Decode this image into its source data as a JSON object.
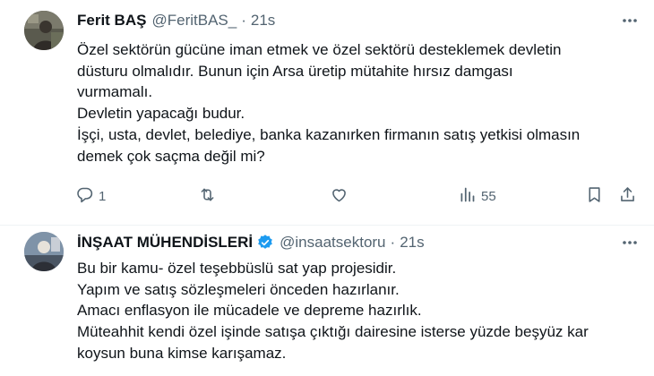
{
  "tweets": [
    {
      "author_name": "Ferit BAŞ",
      "handle": "@FeritBAS_",
      "separator": "·",
      "time": "21s",
      "lines": [
        "Özel sektörün gücüne iman etmek ve özel sektörü desteklemek devletin",
        "düsturu olmalıdır. Bunun için Arsa üretip mütahite hırsız damgası",
        "vurmamalı.",
        "Devletin yapacağı budur.",
        "İşçi, usta, devlet, belediye, banka kazanırken firmanın satış yetkisi olmasın",
        "demek çok saçma değil mi?"
      ],
      "reply_count": "1",
      "views_count": "55",
      "icons": [
        "reply-icon",
        "retweet-icon",
        "like-icon",
        "views-icon",
        "bookmark-icon",
        "share-icon",
        "more-icon"
      ]
    },
    {
      "author_name": "İNŞAAT MÜHENDİSLERİ",
      "handle": "@insaatsektoru",
      "separator": "·",
      "time": "21s",
      "verified": true,
      "lines": [
        "Bu bir kamu- özel teşebbüslü sat yap projesidir.",
        "Yapım ve satış sözleşmeleri önceden hazırlanır.",
        "Amacı enflasyon ile mücadele ve depreme hazırlık.",
        "Müteahhit kendi özel işinde satışa çıktığı dairesine isterse yüzde beşyüz kar",
        "koysun buna kimse karışamaz."
      ],
      "icons": [
        "verified-badge-icon",
        "more-icon"
      ]
    }
  ],
  "colors": {
    "text": "#0f1419",
    "secondary": "#536471",
    "verified": "#1d9bf0",
    "divider": "#eff3f4"
  }
}
